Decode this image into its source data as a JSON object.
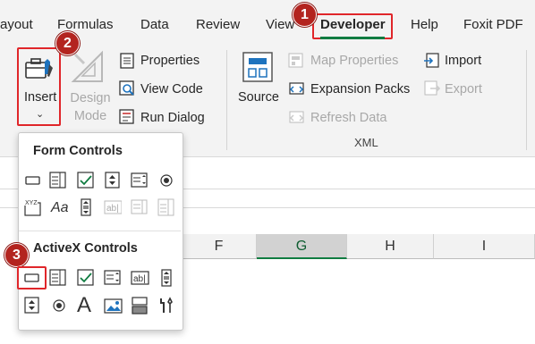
{
  "tabs": [
    {
      "label": "ayout"
    },
    {
      "label": "Formulas"
    },
    {
      "label": "Data"
    },
    {
      "label": "Review"
    },
    {
      "label": "View"
    },
    {
      "label": "Developer"
    },
    {
      "label": "Help"
    },
    {
      "label": "Foxit PDF"
    }
  ],
  "badges": {
    "one": "1",
    "two": "2",
    "three": "3"
  },
  "controls_group": {
    "insert_label": "Insert",
    "design_mode_label": "Design Mode",
    "properties_label": "Properties",
    "view_code_label": "View Code",
    "run_dialog_label": "Run Dialog"
  },
  "xml_group": {
    "source_label": "Source",
    "map_properties_label": "Map Properties",
    "expansion_packs_label": "Expansion Packs",
    "refresh_data_label": "Refresh Data",
    "import_label": "Import",
    "export_label": "Export",
    "group_label": "XML"
  },
  "dropdown": {
    "form_controls_header": "Form Controls",
    "activex_controls_header": "ActiveX Controls",
    "xyz_text": "XYZ",
    "aa_text": "Aa",
    "abl_text": "ab|",
    "big_a_text": "A"
  },
  "columns": [
    "F",
    "G",
    "H",
    "I"
  ],
  "colors": {
    "accent_green": "#107c41",
    "highlight_red": "#e0262a",
    "badge_red": "#b3241f"
  }
}
